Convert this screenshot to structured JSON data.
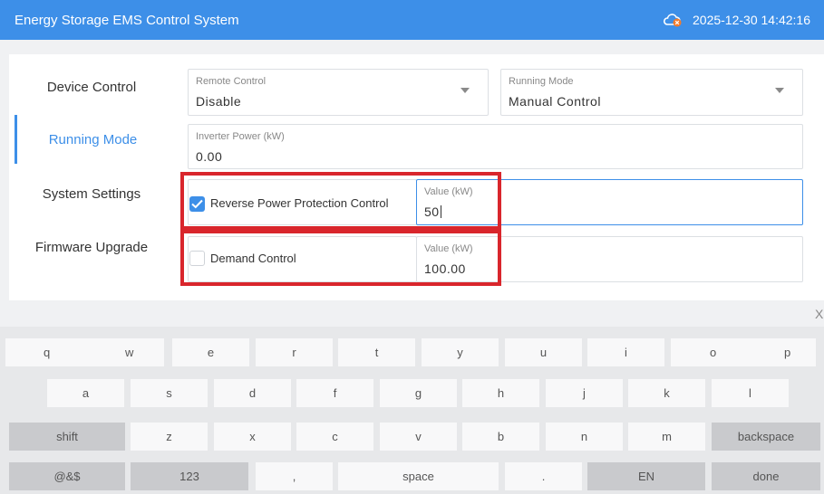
{
  "header": {
    "title": "Energy Storage EMS Control System",
    "datetime": "2025-12-30 14:42:16",
    "status_icon": "cloud-offline-icon"
  },
  "sidebar": {
    "items": [
      {
        "label": "Device Control"
      },
      {
        "label": "Running Mode",
        "active": true
      },
      {
        "label": "System Settings"
      },
      {
        "label": "Firmware Upgrade"
      }
    ]
  },
  "form": {
    "remote_control": {
      "label": "Remote Control",
      "value": "Disable"
    },
    "running_mode": {
      "label": "Running Mode",
      "value": "Manual Control"
    },
    "inverter_power": {
      "label": "Inverter Power (kW)",
      "value": "0.00"
    },
    "reverse_power": {
      "label": "Reverse Power Protection Control",
      "checked": true,
      "value_label": "Value (kW)",
      "value": "50"
    },
    "demand": {
      "label": "Demand Control",
      "checked": false,
      "value_label": "Value (kW)",
      "value": "100.00"
    }
  },
  "keyboard": {
    "close": "X",
    "row1": [
      "q",
      "w",
      "e",
      "r",
      "t",
      "y",
      "u",
      "i",
      "o",
      "p"
    ],
    "row2": [
      "a",
      "s",
      "d",
      "f",
      "g",
      "h",
      "j",
      "k",
      "l"
    ],
    "row3": [
      "shift",
      "z",
      "x",
      "c",
      "v",
      "b",
      "n",
      "m",
      "backspace"
    ],
    "row4": [
      "@&$",
      "123",
      ",",
      "space",
      ".",
      "EN",
      "done"
    ]
  },
  "colors": {
    "accent": "#3d8fe8",
    "highlight": "#d9262c"
  }
}
